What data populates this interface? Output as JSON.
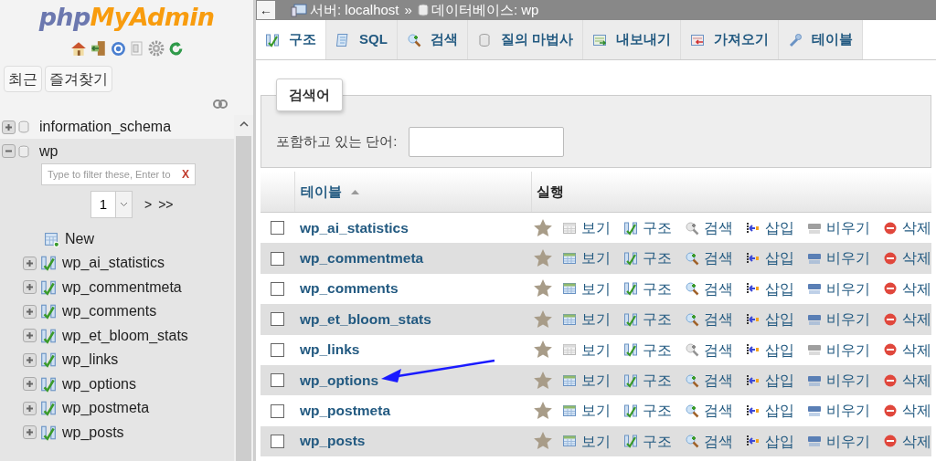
{
  "logo": {
    "part_1": "php",
    "part_2": "MyAdmin"
  },
  "sidebar_buttons": [
    "최근",
    "즐겨찾기"
  ],
  "tree": [
    {
      "name": "information_schema",
      "expanded": false
    },
    {
      "name": "wp",
      "expanded": true,
      "filter": {
        "placeholder": "Type to filter these, Enter to",
        "clear": "X"
      },
      "pager": {
        "page": "1",
        "next": ">",
        "last": ">>"
      },
      "new_item": "New",
      "children": [
        {
          "name": "wp_ai_statistics",
          "expanded": false
        },
        {
          "name": "wp_commentmeta",
          "expanded": false
        },
        {
          "name": "wp_comments",
          "expanded": false
        },
        {
          "name": "wp_et_bloom_stats",
          "expanded": false
        },
        {
          "name": "wp_links",
          "expanded": false
        },
        {
          "name": "wp_options",
          "expanded": false
        },
        {
          "name": "wp_postmeta",
          "expanded": false
        },
        {
          "name": "wp_posts",
          "expanded": false
        }
      ]
    }
  ],
  "back": "←",
  "breadcrumb": [
    {
      "label": "서버: localhost"
    },
    {
      "separator": "»",
      "label": "데이터베이스: wp"
    }
  ],
  "tabs": [
    {
      "kind": "structure",
      "label": "구조",
      "selected": true
    },
    {
      "kind": "sql",
      "label": "SQL",
      "selected": false
    },
    {
      "kind": "search",
      "label": "검색",
      "selected": false
    },
    {
      "kind": "query",
      "label": "질의 마법사",
      "selected": false
    },
    {
      "kind": "export",
      "label": "내보내기",
      "selected": false
    },
    {
      "kind": "import",
      "label": "가져오기",
      "selected": false
    },
    {
      "kind": "operations",
      "label": "테이블",
      "selected": false
    }
  ],
  "search_box": {
    "legend": "검색어",
    "label": "포함하고 있는 단어:"
  },
  "table": {
    "columns": [
      "테이블",
      "실행"
    ],
    "rows": [
      {
        "name": "wp_ai_statistics",
        "checked": false,
        "pointed": false,
        "actions": [
          {
            "kind": "view",
            "label": "보기",
            "disabled": true
          },
          {
            "kind": "structure",
            "label": "구조",
            "disabled": false
          },
          {
            "kind": "search",
            "label": "검색",
            "disabled": true
          },
          {
            "kind": "insert",
            "label": "삽입",
            "disabled": false
          },
          {
            "kind": "empty",
            "label": "비우기",
            "disabled": true
          },
          {
            "kind": "drop",
            "label": "삭제",
            "disabled": false
          }
        ]
      },
      {
        "name": "wp_commentmeta",
        "checked": false,
        "pointed": false,
        "actions": [
          {
            "kind": "view",
            "label": "보기",
            "disabled": false
          },
          {
            "kind": "structure",
            "label": "구조",
            "disabled": false
          },
          {
            "kind": "search",
            "label": "검색",
            "disabled": false
          },
          {
            "kind": "insert",
            "label": "삽입",
            "disabled": false
          },
          {
            "kind": "empty",
            "label": "비우기",
            "disabled": false
          },
          {
            "kind": "drop",
            "label": "삭제",
            "disabled": false
          }
        ]
      },
      {
        "name": "wp_comments",
        "checked": false,
        "pointed": false,
        "actions": [
          {
            "kind": "view",
            "label": "보기",
            "disabled": false
          },
          {
            "kind": "structure",
            "label": "구조",
            "disabled": false
          },
          {
            "kind": "search",
            "label": "검색",
            "disabled": false
          },
          {
            "kind": "insert",
            "label": "삽입",
            "disabled": false
          },
          {
            "kind": "empty",
            "label": "비우기",
            "disabled": false
          },
          {
            "kind": "drop",
            "label": "삭제",
            "disabled": false
          }
        ]
      },
      {
        "name": "wp_et_bloom_stats",
        "checked": false,
        "pointed": false,
        "actions": [
          {
            "kind": "view",
            "label": "보기",
            "disabled": false
          },
          {
            "kind": "structure",
            "label": "구조",
            "disabled": false
          },
          {
            "kind": "search",
            "label": "검색",
            "disabled": false
          },
          {
            "kind": "insert",
            "label": "삽입",
            "disabled": false
          },
          {
            "kind": "empty",
            "label": "비우기",
            "disabled": false
          },
          {
            "kind": "drop",
            "label": "삭제",
            "disabled": false
          }
        ]
      },
      {
        "name": "wp_links",
        "checked": false,
        "pointed": false,
        "actions": [
          {
            "kind": "view",
            "label": "보기",
            "disabled": true
          },
          {
            "kind": "structure",
            "label": "구조",
            "disabled": false
          },
          {
            "kind": "search",
            "label": "검색",
            "disabled": true
          },
          {
            "kind": "insert",
            "label": "삽입",
            "disabled": false
          },
          {
            "kind": "empty",
            "label": "비우기",
            "disabled": true
          },
          {
            "kind": "drop",
            "label": "삭제",
            "disabled": false
          }
        ]
      },
      {
        "name": "wp_options",
        "checked": false,
        "pointed": true,
        "actions": [
          {
            "kind": "view",
            "label": "보기",
            "disabled": false
          },
          {
            "kind": "structure",
            "label": "구조",
            "disabled": false
          },
          {
            "kind": "search",
            "label": "검색",
            "disabled": false
          },
          {
            "kind": "insert",
            "label": "삽입",
            "disabled": false
          },
          {
            "kind": "empty",
            "label": "비우기",
            "disabled": false
          },
          {
            "kind": "drop",
            "label": "삭제",
            "disabled": false
          }
        ]
      },
      {
        "name": "wp_postmeta",
        "checked": false,
        "pointed": false,
        "actions": [
          {
            "kind": "view",
            "label": "보기",
            "disabled": false
          },
          {
            "kind": "structure",
            "label": "구조",
            "disabled": false
          },
          {
            "kind": "search",
            "label": "검색",
            "disabled": false
          },
          {
            "kind": "insert",
            "label": "삽입",
            "disabled": false
          },
          {
            "kind": "empty",
            "label": "비우기",
            "disabled": false
          },
          {
            "kind": "drop",
            "label": "삭제",
            "disabled": false
          }
        ]
      },
      {
        "name": "wp_posts",
        "checked": false,
        "pointed": false,
        "actions": [
          {
            "kind": "view",
            "label": "보기",
            "disabled": false
          },
          {
            "kind": "structure",
            "label": "구조",
            "disabled": false
          },
          {
            "kind": "search",
            "label": "검색",
            "disabled": false
          },
          {
            "kind": "insert",
            "label": "삽입",
            "disabled": false
          },
          {
            "kind": "empty",
            "label": "비우기",
            "disabled": false
          },
          {
            "kind": "drop",
            "label": "삭제",
            "disabled": false
          }
        ]
      }
    ]
  }
}
